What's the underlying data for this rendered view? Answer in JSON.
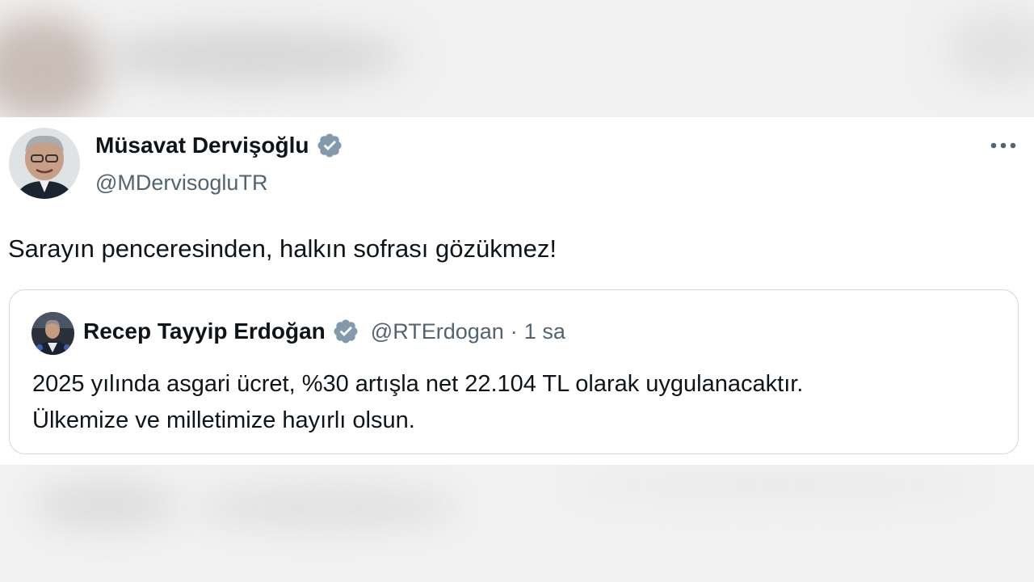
{
  "tweet": {
    "author_name": "Müsavat Dervişoğlu",
    "author_handle": "@MDervisogluTR",
    "text": "Sarayın penceresinden, halkın sofrası gözükmez!",
    "verified": true,
    "more_icon": "more-horizontal-icon"
  },
  "quoted_tweet": {
    "author_name": "Recep Tayyip Erdoğan",
    "author_handle": "@RTErdogan",
    "separator": "·",
    "time": "1 sa",
    "verified": true,
    "text_line1": "2025 yılında asgari ücret, %30 artışla net 22.104 TL olarak uygulanacaktır.",
    "text_line2": "Ülkemize ve milletimize hayırlı olsun."
  },
  "colors": {
    "text_primary": "#0f1419",
    "text_secondary": "#536471",
    "verified_badge": "#829aab",
    "border": "#cfd9de"
  }
}
